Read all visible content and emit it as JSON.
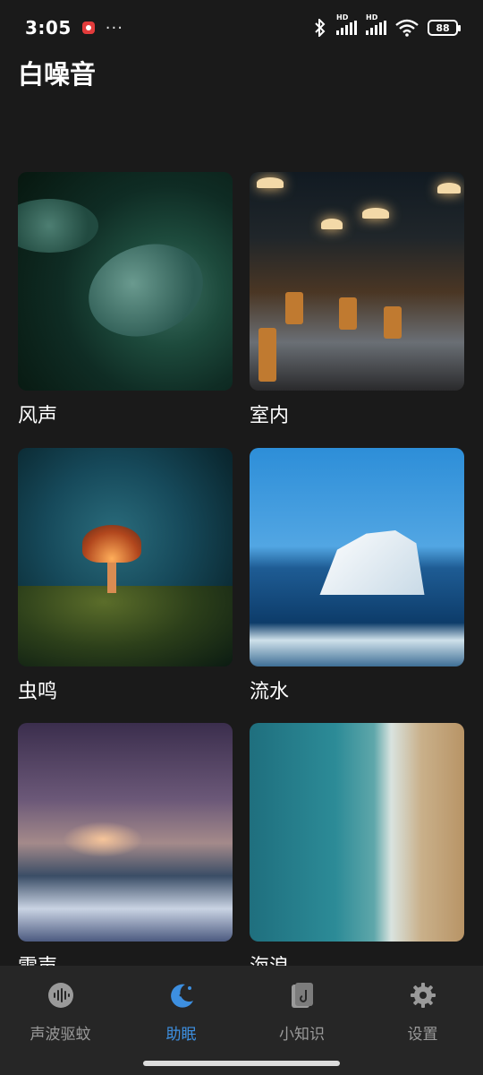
{
  "status_bar": {
    "time": "3:05",
    "more": "···",
    "signal1_tag": "HD",
    "signal2_tag": "HD",
    "battery": "88"
  },
  "page": {
    "title": "白噪音"
  },
  "sounds": [
    {
      "label": "风声"
    },
    {
      "label": "室内"
    },
    {
      "label": "虫鸣"
    },
    {
      "label": "流水"
    },
    {
      "label": "雷声"
    },
    {
      "label": "海浪"
    }
  ],
  "nav": {
    "items": [
      {
        "label": "声波驱蚊",
        "icon": "soundwave-icon",
        "active": false
      },
      {
        "label": "助眠",
        "icon": "moon-star-icon",
        "active": true
      },
      {
        "label": "小知识",
        "icon": "book-icon",
        "active": false
      },
      {
        "label": "设置",
        "icon": "gear-icon",
        "active": false
      }
    ],
    "active_color": "#3d8fe0",
    "inactive_color": "#9a9a9a"
  }
}
